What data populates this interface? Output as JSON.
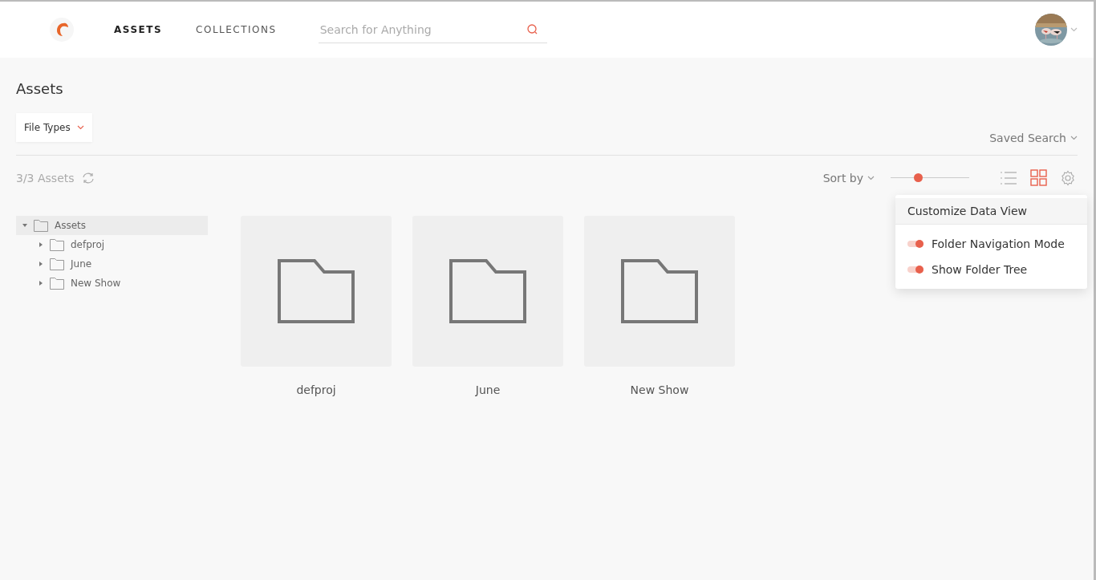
{
  "nav": {
    "tabs": [
      {
        "label": "ASSETS",
        "selected": true
      },
      {
        "label": "COLLECTIONS",
        "selected": false
      }
    ],
    "search": {
      "placeholder": "Search for Anything"
    }
  },
  "page_title": "Assets",
  "file_types": "File Types",
  "saved_search": "Saved Search",
  "asset_count": "3/3 Assets",
  "sort_by": "Sort by",
  "size_slider": {
    "level": 0.35
  },
  "view_modes": [
    {
      "kind": "list",
      "selected": false
    },
    {
      "kind": "grid",
      "selected": true
    }
  ],
  "settings_menu": {
    "title": "Customize Data View",
    "toggles": [
      {
        "label": "Folder Navigation Mode",
        "on": true
      },
      {
        "label": "Show Folder Tree",
        "on": true
      }
    ]
  },
  "tree": [
    {
      "label": "Assets",
      "expanded": true,
      "selected": true,
      "children": [
        {
          "label": "defproj",
          "expanded": false,
          "selected": false
        },
        {
          "label": "June",
          "expanded": false,
          "selected": false
        },
        {
          "label": "New Show",
          "expanded": false,
          "selected": false
        }
      ]
    }
  ],
  "folders": [
    {
      "name": "defproj"
    },
    {
      "name": "June"
    },
    {
      "name": "New Show"
    }
  ]
}
